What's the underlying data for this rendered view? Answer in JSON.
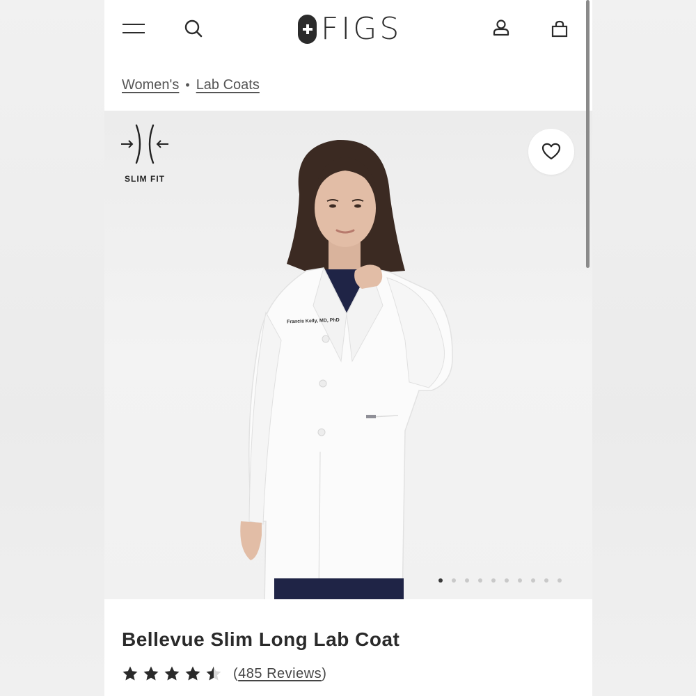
{
  "brand": {
    "name": "FIGS"
  },
  "header": {
    "icons": [
      "hamburger-menu-icon",
      "search-icon",
      "account-icon",
      "shopping-bag-icon"
    ]
  },
  "breadcrumb": {
    "items": [
      {
        "label": "Women's"
      },
      {
        "label": "Lab Coats"
      }
    ],
    "separator": "•"
  },
  "gallery": {
    "fit_badge": "SLIM FIT",
    "embroidery_text": "Francis Kelly, MD, PhD",
    "slide_count": 10,
    "active_slide": 1
  },
  "product": {
    "title": "Bellevue Slim Long Lab Coat",
    "rating_value": 4.5,
    "rating_max": 5,
    "reviews_label": "485 Reviews"
  },
  "colors": {
    "text_dark": "#2a2a2a",
    "background": "#ffffff",
    "image_bg": "#efefef",
    "dot_active": "#3a3a3a",
    "dot_inactive": "#c9c9c9"
  }
}
